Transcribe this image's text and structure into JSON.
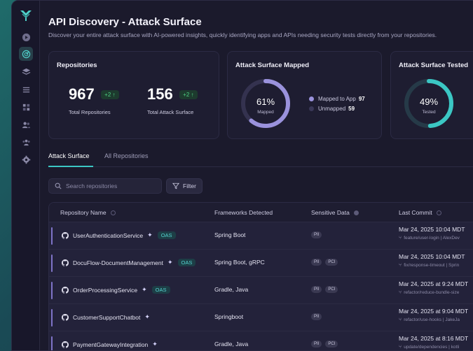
{
  "page": {
    "title": "API Discovery - Attack Surface",
    "subtitle": "Discover your entire attack surface with AI-powered insights, quickly identifying apps and APIs needing security tests directly from your repositories."
  },
  "sidebar": {
    "items": [
      {
        "icon": "play-icon"
      },
      {
        "icon": "radar-icon",
        "active": true
      },
      {
        "icon": "layers-icon"
      },
      {
        "icon": "list-icon"
      },
      {
        "icon": "grid-icon"
      },
      {
        "icon": "users-icon"
      },
      {
        "icon": "team-icon"
      },
      {
        "icon": "gear-icon"
      }
    ]
  },
  "cards": {
    "repositories": {
      "title": "Repositories",
      "total_repos": "967",
      "total_repos_delta": "+2 ↑",
      "total_repos_label": "Total Repositories",
      "attack_surface": "156",
      "attack_surface_delta": "+2 ↑",
      "attack_surface_label": "Total Attack Surface"
    },
    "mapped": {
      "title": "Attack Surface Mapped",
      "percent_label": "61%",
      "percent_value": 0.61,
      "center_caption": "Mapped",
      "legend": [
        {
          "label": "Mapped to App",
          "value": "97",
          "color": "#9a92dc"
        },
        {
          "label": "Unmapped",
          "value": "59",
          "color": "#3a3858"
        }
      ]
    },
    "tested": {
      "title": "Attack Surface Tested",
      "percent_label": "49%",
      "percent_value": 0.49,
      "center_caption": "Tested"
    }
  },
  "tabs": [
    {
      "label": "Attack Surface",
      "active": true
    },
    {
      "label": "All Repositories",
      "active": false
    }
  ],
  "search": {
    "placeholder": "Search repositories"
  },
  "filter_label": "Filter",
  "table": {
    "columns": [
      "Repository Name",
      "Frameworks Detected",
      "Sensitive Data",
      "Last Commit"
    ],
    "rows": [
      {
        "name": "UserAuthenticationService",
        "oas": "OAS",
        "frameworks": "Spring Boot",
        "tags": [
          "PII"
        ],
        "date": "Mar 24, 2025 10:04 MDT",
        "branch": "feature/user-login | AlexDev"
      },
      {
        "name": "DocuFlow-DocumentManagement",
        "oas": "OAS",
        "frameworks": "Spring Boot, gRPC",
        "tags": [
          "PII",
          "PCI"
        ],
        "date": "Mar 24, 2025 10:04 MDT",
        "branch": "fix/response-timeout | Sprin"
      },
      {
        "name": "OrderProcessingService",
        "oas": "OAS",
        "frameworks": "Gradle, Java",
        "tags": [
          "PII",
          "PCI"
        ],
        "date": "Mar 24, 2025 at 9:24 MDT",
        "branch": "refactor/reduce-bundle-size"
      },
      {
        "name": "CustomerSupportChatbot",
        "oas": "",
        "frameworks": "Springboot",
        "tags": [
          "PII"
        ],
        "date": "Mar 24, 2025 at 9:04 MDT",
        "branch": "refactor/use-hooks | JakeJa"
      },
      {
        "name": "PaymentGatewayIntegration",
        "oas": "",
        "frameworks": "Gradle, Java",
        "tags": [
          "PII",
          "PCI"
        ],
        "date": "Mar 24, 2025 at 8:16 MDT",
        "branch": "update/dependencies | kotli"
      }
    ]
  },
  "colors": {
    "accent": "#3bc7c4",
    "mapped": "#9a92dc",
    "success": "#4fcf83"
  }
}
